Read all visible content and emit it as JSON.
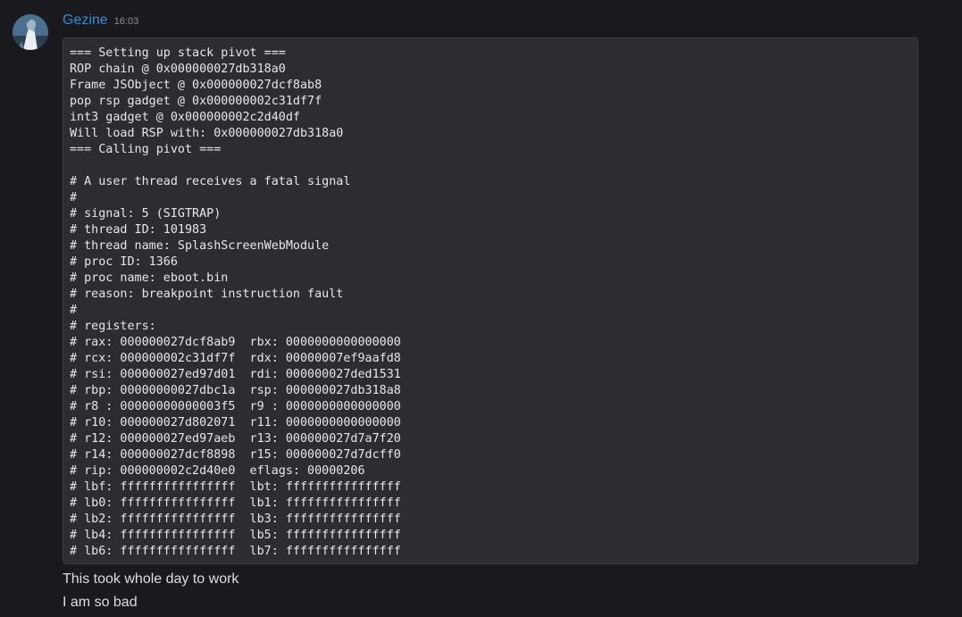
{
  "message": {
    "author": "Gezine",
    "timestamp": "16:03",
    "avatar_icon": "user-avatar-icon",
    "code_lines": [
      "=== Setting up stack pivot ===",
      "ROP chain @ 0x000000027db318a0",
      "Frame JSObject @ 0x000000027dcf8ab8",
      "pop rsp gadget @ 0x000000002c31df7f",
      "int3 gadget @ 0x000000002c2d40df",
      "Will load RSP with: 0x000000027db318a0",
      "=== Calling pivot ===",
      "",
      "# A user thread receives a fatal signal",
      "#",
      "# signal: 5 (SIGTRAP)",
      "# thread ID: 101983",
      "# thread name: SplashScreenWebModule",
      "# proc ID: 1366",
      "# proc name: eboot.bin",
      "# reason: breakpoint instruction fault",
      "#",
      "# registers:",
      "# rax: 000000027dcf8ab9  rbx: 0000000000000000",
      "# rcx: 000000002c31df7f  rdx: 00000007ef9aafd8",
      "# rsi: 000000027ed97d01  rdi: 000000027ded1531",
      "# rbp: 00000000027dbc1a  rsp: 000000027db318a8",
      "# r8 : 00000000000003f5  r9 : 0000000000000000",
      "# r10: 000000027d802071  r11: 0000000000000000",
      "# r12: 000000027ed97aeb  r13: 000000027d7a7f20",
      "# r14: 000000027dcf8898  r15: 000000027d7dcff0",
      "# rip: 000000002c2d40e0  eflags: 00000206",
      "# lbf: ffffffffffffffff  lbt: ffffffffffffffff",
      "# lb0: ffffffffffffffff  lb1: ffffffffffffffff",
      "# lb2: ffffffffffffffff  lb3: ffffffffffffffff",
      "# lb4: ffffffffffffffff  lb5: ffffffffffffffff",
      "# lb6: ffffffffffffffff  lb7: ffffffffffffffff"
    ],
    "text_lines": [
      "This took whole day to work",
      "I am so bad"
    ]
  },
  "colors": {
    "background": "#1a1a1e",
    "username": "#2f8fcf",
    "code_background": "#2b2d31"
  }
}
